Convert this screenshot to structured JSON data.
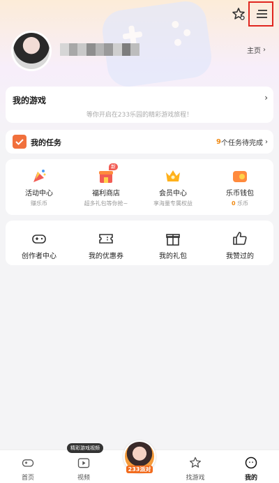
{
  "profile": {
    "homepage_label": "主页"
  },
  "my_games": {
    "title": "我的游戏",
    "empty_text": "等你开启在233乐园的精彩游戏旅程！"
  },
  "tasks": {
    "title": "我的任务",
    "count": "9",
    "status_suffix": "个任务待完成"
  },
  "services": [
    {
      "label": "活动中心",
      "sub": "赚乐币",
      "icon": "party-icon"
    },
    {
      "label": "福利商店",
      "sub": "超多礼包等你抢~",
      "badge": "新",
      "icon": "shop-icon"
    },
    {
      "label": "会员中心",
      "sub": "享海量专属权益",
      "icon": "crown-icon"
    },
    {
      "label": "乐币钱包",
      "sub_value": "0",
      "sub_unit": "乐币",
      "icon": "wallet-icon"
    }
  ],
  "tools": [
    {
      "label": "创作者中心",
      "icon": "gamepad-icon"
    },
    {
      "label": "我的优惠券",
      "icon": "coupon-icon"
    },
    {
      "label": "我的礼包",
      "icon": "gift-icon"
    },
    {
      "label": "我赞过的",
      "icon": "thumbs-up-icon"
    }
  ],
  "tabbar": {
    "tabs": [
      {
        "label": "首页",
        "icon": "gamepad-icon"
      },
      {
        "label": "视频",
        "icon": "video-icon"
      },
      {
        "label": "",
        "icon": "center-game-icon"
      },
      {
        "label": "找游戏",
        "icon": "star-icon"
      },
      {
        "label": "我的",
        "icon": "profile-icon"
      }
    ],
    "video_tooltip": "精彩游戏视频",
    "center_logo_text": "233派对"
  },
  "colors": {
    "accent_orange": "#f08a14",
    "highlight_box": "#e0261f"
  }
}
